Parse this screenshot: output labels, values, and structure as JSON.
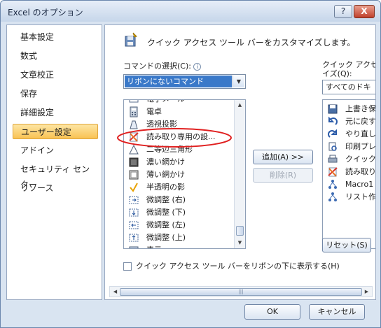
{
  "window": {
    "title": "Excel のオプション",
    "help_label": "?",
    "close_label": "X"
  },
  "nav": {
    "items": [
      {
        "label": "基本設定"
      },
      {
        "label": "数式"
      },
      {
        "label": "文章校正"
      },
      {
        "label": "保存"
      },
      {
        "label": "詳細設定"
      },
      {
        "label": "ユーザー設定",
        "selected": true
      },
      {
        "label": "アドイン"
      },
      {
        "label": "セキュリティ センター"
      },
      {
        "label": "リソース"
      }
    ]
  },
  "content": {
    "heading": "クイック アクセス ツール バーをカスタマイズします。",
    "choose_commands_label": "コマンドの選択(C):",
    "info_icon": "i",
    "choose_commands_value": "リボンにないコマンド",
    "qat_label_line1": "クイック アクセス",
    "qat_label_line2": "イズ(Q):",
    "qat_combo_value": "すべてのドキュメ",
    "command_list": [
      {
        "label": "電子メール",
        "icon": "email-icon"
      },
      {
        "label": "電卓",
        "icon": "calculator-icon"
      },
      {
        "label": "透視投影",
        "icon": "perspective-icon"
      },
      {
        "label": "読み取り専用の設...",
        "icon": "read-only-icon"
      },
      {
        "label": "二等辺三角形",
        "icon": "triangle-icon"
      },
      {
        "label": "濃い網かけ",
        "icon": "dark-shade-icon"
      },
      {
        "label": "薄い網かけ",
        "icon": "light-shade-icon"
      },
      {
        "label": "半透明の影",
        "icon": "checkmark-icon"
      },
      {
        "label": "微調整 (右)",
        "icon": "nudge-right-icon"
      },
      {
        "label": "微調整 (下)",
        "icon": "nudge-down-icon"
      },
      {
        "label": "微調整 (左)",
        "icon": "nudge-left-icon"
      },
      {
        "label": "微調整 (上)",
        "icon": "nudge-up-icon"
      },
      {
        "label": "表示",
        "icon": "display-icon"
      }
    ],
    "add_button": "追加(A) >>",
    "remove_button": "削除(R)",
    "qat_list": [
      {
        "label": "上書き保",
        "icon": "save-icon"
      },
      {
        "label": "元に戻す",
        "icon": "undo-icon"
      },
      {
        "label": "やり直し",
        "icon": "redo-icon"
      },
      {
        "label": "印刷プレ",
        "icon": "print-preview-icon"
      },
      {
        "label": "クイック印",
        "icon": "quick-print-icon"
      },
      {
        "label": "読み取り",
        "icon": "read-only-icon"
      },
      {
        "label": "Macro1",
        "icon": "macro-icon"
      },
      {
        "label": "リスト作成",
        "icon": "list-create-icon"
      }
    ],
    "reset_button": "リセット(S)",
    "checkbox_label": "クイック アクセス ツール バーをリボンの下に表示する(H)",
    "checkbox_checked": false
  },
  "footer": {
    "ok_button": "OK",
    "cancel_button": "キャンセル"
  },
  "colors": {
    "selection": "#3a79c9",
    "nav_selected": "#f9c253",
    "annotation": "#e02020"
  }
}
